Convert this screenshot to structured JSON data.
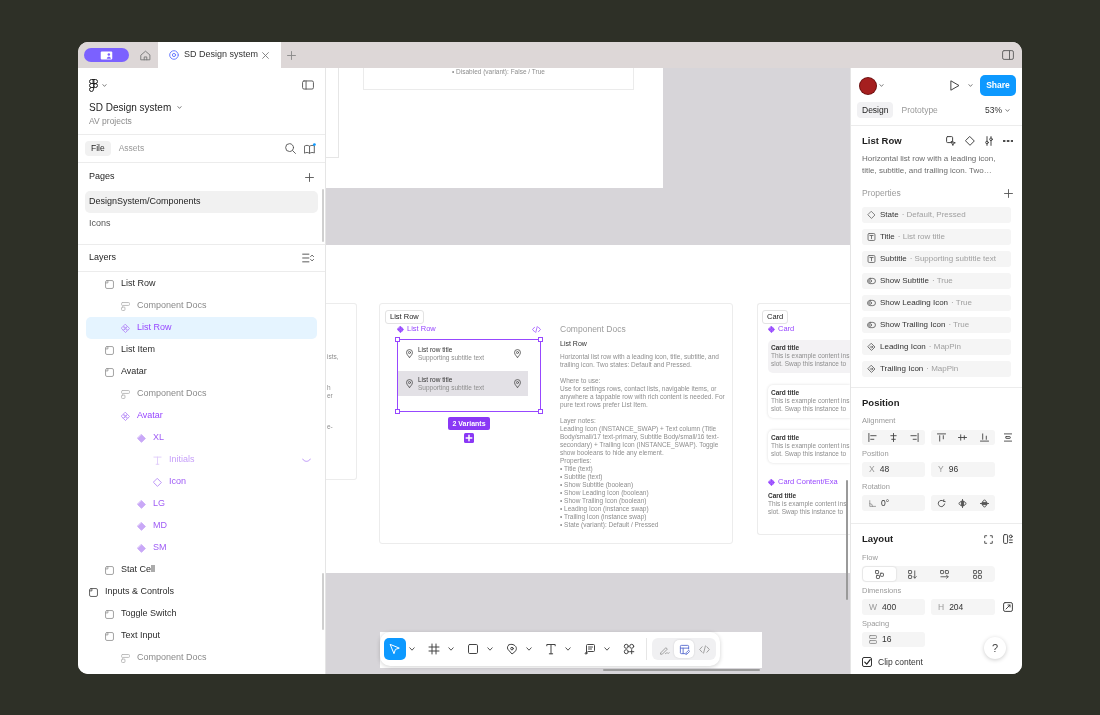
{
  "tab_bar": {
    "tabs": [
      {
        "kind": "home",
        "selected": false
      },
      {
        "kind": "file",
        "label": "SD Design system",
        "selected": true
      }
    ]
  },
  "file_panel": {
    "file_name": "SD Design system",
    "project": "AV projects",
    "tabs": [
      {
        "label": "File",
        "selected": true
      },
      {
        "label": "Assets",
        "selected": false
      }
    ],
    "pages_title": "Pages",
    "pages": [
      {
        "name": "DesignSystem/Components",
        "selected": true
      },
      {
        "name": "Icons",
        "selected": false
      }
    ],
    "layers_title": "Layers",
    "layers": [
      {
        "children": [
          {
            "name": "List Row",
            "kind": "frame",
            "selected": false,
            "hidden": false,
            "children": [
              {
                "name": "Component Docs",
                "kind": "docs",
                "selected": false,
                "hidden": false
              },
              {
                "name": "List Row",
                "kind": "component_set",
                "selected": true,
                "hidden": false
              }
            ]
          },
          {
            "name": "List Item",
            "kind": "frame",
            "selected": false,
            "hidden": false
          },
          {
            "name": "Avatar",
            "kind": "frame",
            "selected": false,
            "hidden": false,
            "children": [
              {
                "name": "Component Docs",
                "kind": "docs",
                "selected": false,
                "hidden": false
              },
              {
                "name": "Avatar",
                "kind": "component_set",
                "selected": false,
                "hidden": false,
                "children": [
                  {
                    "name": "XL",
                    "kind": "variant",
                    "selected": false,
                    "hidden": false,
                    "children": [
                      {
                        "name": "Initials",
                        "kind": "text",
                        "selected": false,
                        "hidden": true
                      },
                      {
                        "name": "Icon",
                        "kind": "instance",
                        "selected": false,
                        "hidden": false
                      }
                    ]
                  },
                  {
                    "name": "LG",
                    "kind": "variant",
                    "selected": false,
                    "hidden": false
                  },
                  {
                    "name": "MD",
                    "kind": "variant",
                    "selected": false,
                    "hidden": false
                  },
                  {
                    "name": "SM",
                    "kind": "variant",
                    "selected": false,
                    "hidden": false
                  }
                ]
              }
            ]
          },
          {
            "name": "Stat Cell",
            "kind": "frame",
            "selected": false,
            "hidden": false
          }
        ]
      },
      {
        "name": "Inputs & Controls",
        "kind": "section",
        "selected": false,
        "hidden": false,
        "children": [
          {
            "name": "Toggle Switch",
            "kind": "frame",
            "selected": false,
            "hidden": false
          },
          {
            "name": "Text Input",
            "kind": "frame",
            "selected": false,
            "hidden": false,
            "children": [
              {
                "name": "Component Docs",
                "kind": "docs",
                "selected": false,
                "hidden": false
              }
            ]
          }
        ]
      }
    ]
  },
  "canvas": {
    "top_note": "• Disabled (variant): False / True",
    "left_frame_fragments": [
      [
        "ists,"
      ],
      [
        "h",
        "er"
      ],
      [
        "e-"
      ]
    ],
    "list_row_frame": {
      "label": "List Row",
      "component": "List Row",
      "variants": [
        {
          "title": "List row title",
          "subtitle": "Supporting subtitle text",
          "pressed": false
        },
        {
          "title": "List row title",
          "subtitle": "Supporting subtitle text",
          "pressed": true
        }
      ],
      "variants_badge": "2 Variants",
      "docs": {
        "heading": "Component Docs",
        "title": "List Row",
        "groups": [
          [
            [
              "Horizontal list row with a leading icon, title, subtitle, and",
              "trailing icon. Two states: Default and Pressed."
            ]
          ],
          [
            [
              "Where to use:"
            ],
            [
              "Use for settings rows, contact lists, navigable items, or",
              "anywhere a tappable row with rich content is needed. For",
              "pure text rows prefer List Item."
            ]
          ],
          [
            [
              "Layer notes:"
            ],
            [
              "Leading Icon (INSTANCE_SWAP) + Text column (Title",
              "Body/small/17 text-primary, Subtitle Body/small/16 text-",
              "secondary) + Trailing Icon (INSTANCE_SWAP). Toggle",
              "show booleans to hide any element."
            ],
            [
              "Properties:"
            ],
            [
              "• Title (text)"
            ],
            [
              "• Subtitle (text)"
            ],
            [
              "• Show Subtitle (boolean)"
            ],
            [
              "• Show Leading Icon (boolean)"
            ],
            [
              "• Show Trailing Icon (boolean)"
            ],
            [
              "• Leading Icon (instance swap)"
            ],
            [
              "• Trailing Icon (instance swap)"
            ],
            [
              "• State (variant): Default / Pressed"
            ]
          ]
        ]
      }
    },
    "card_frame": {
      "label": "Card",
      "component": "Card",
      "cards": [
        {
          "kind": "filled",
          "title": "Card title",
          "lines": [
            "This is example content ins",
            "slot. Swap this instance to"
          ]
        },
        {
          "kind": "elevated",
          "title": "Card title",
          "lines": [
            "This is example content ins",
            "slot. Swap this instance to"
          ]
        },
        {
          "kind": "elevated",
          "title": "Card title",
          "lines": [
            "This is example content ins",
            "slot. Swap this instance to"
          ]
        }
      ],
      "second_component": "Card Content/Exa",
      "example": {
        "title": "Card title",
        "lines": [
          "This is example content ins",
          "slot. Swap this instance to"
        ]
      }
    }
  },
  "toolbar": {
    "tools": [
      {
        "kind": "move",
        "selected": true,
        "menu": true
      },
      {
        "kind": "frame",
        "selected": false,
        "menu": true
      },
      {
        "kind": "shape",
        "selected": false,
        "menu": true
      },
      {
        "kind": "pen",
        "selected": false,
        "menu": true
      },
      {
        "kind": "text",
        "selected": false,
        "menu": true
      },
      {
        "kind": "comment",
        "selected": false,
        "menu": true
      },
      {
        "kind": "actions",
        "selected": false,
        "menu": false
      }
    ],
    "modes": [
      {
        "kind": "draw",
        "selected": false
      },
      {
        "kind": "design",
        "selected": true
      },
      {
        "kind": "dev",
        "selected": false
      }
    ]
  },
  "inspector": {
    "share": "Share",
    "tabs": [
      {
        "label": "Design",
        "selected": true
      },
      {
        "label": "Prototype",
        "selected": false
      }
    ],
    "zoom": "53%",
    "selection": {
      "name": "List Row",
      "description": "Horizontal list row with a leading icon, title, subtitle, and trailing icon. Two…"
    },
    "properties_title": "Properties",
    "properties": [
      {
        "kind": "variant",
        "name": "State",
        "value": "· Default, Pressed"
      },
      {
        "kind": "text",
        "name": "Title",
        "value": "· List row title"
      },
      {
        "kind": "text",
        "name": "Subtitle",
        "value": "· Supporting subtitle text"
      },
      {
        "kind": "boolean",
        "name": "Show Subtitle",
        "value": "· True"
      },
      {
        "kind": "boolean",
        "name": "Show Leading Icon",
        "value": "· True"
      },
      {
        "kind": "boolean",
        "name": "Show Trailing Icon",
        "value": "· True"
      },
      {
        "kind": "instance_swap",
        "name": "Leading Icon",
        "value": "· MapPin"
      },
      {
        "kind": "instance_swap",
        "name": "Trailing Icon",
        "value": "· MapPin"
      }
    ],
    "position": {
      "title": "Position",
      "alignment_label": "Alignment",
      "position_label": "Position",
      "x": {
        "label": "X",
        "value": "48"
      },
      "y": {
        "label": "Y",
        "value": "96"
      },
      "rotation_label": "Rotation",
      "rotation": "0°"
    },
    "layout": {
      "title": "Layout",
      "flow_label": "Flow",
      "flow": [
        {
          "kind": "free",
          "selected": true
        },
        {
          "kind": "vertical",
          "selected": false
        },
        {
          "kind": "horizontal",
          "selected": false
        },
        {
          "kind": "grid",
          "selected": false
        }
      ],
      "dimensions_label": "Dimensions",
      "width": {
        "label": "W",
        "value": "400"
      },
      "height": {
        "label": "H",
        "value": "204"
      },
      "spacing_label": "Spacing",
      "spacing": "16",
      "clip_content": {
        "label": "Clip content",
        "checked": true
      }
    },
    "help": "?"
  }
}
